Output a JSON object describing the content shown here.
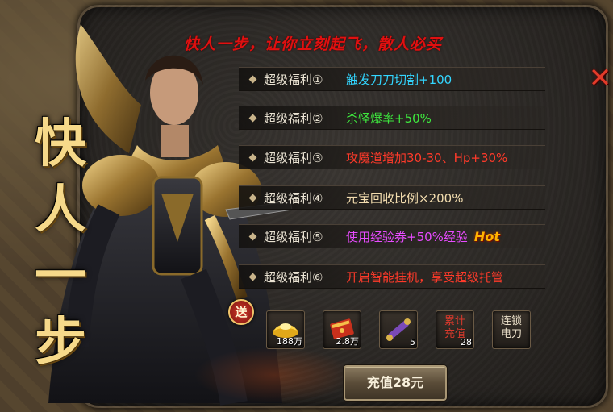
{
  "slogan": "快人一步，让你立刻起飞，散人必买",
  "close_symbol": "✕",
  "title_chars": [
    "快",
    "人",
    "一",
    "步"
  ],
  "benefits": [
    {
      "label": "超级福利①",
      "desc": "触发刀刀切割+100",
      "color": "#33d6ff"
    },
    {
      "label": "超级福利②",
      "desc": "杀怪爆率+50%",
      "color": "#3ee83e"
    },
    {
      "label": "超级福利③",
      "desc": "攻魔道增加30-30、Hp+30%",
      "color": "#ff3a2a"
    },
    {
      "label": "超级福利④",
      "desc": "元宝回收比例×200%",
      "color": "#f2dcae"
    },
    {
      "label": "超级福利⑤",
      "desc": "使用经验券+50%经验",
      "color": "#e84bff",
      "tag": "Hot"
    },
    {
      "label": "超级福利⑥",
      "desc": "开启智能挂机，享受超级托管",
      "color": "#ff3a2a"
    }
  ],
  "send_badge": "送",
  "items": [
    {
      "icon": "gold-ingot-icon",
      "count": "188万"
    },
    {
      "icon": "red-envelope-icon",
      "count": "2.8万"
    },
    {
      "icon": "scroll-icon",
      "count": "5"
    },
    {
      "icon": "recharge-card-icon",
      "text": "累计\n充值",
      "count": "28"
    },
    {
      "icon": "chain-lightning-skill-icon",
      "text": "连锁\n电刀"
    }
  ],
  "recharge_button": "充值28元"
}
